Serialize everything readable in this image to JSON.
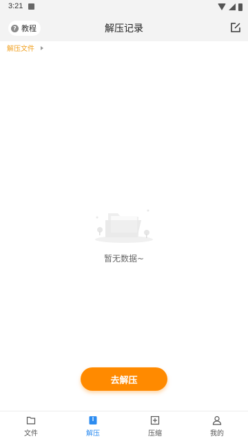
{
  "status_bar": {
    "time": "3:21"
  },
  "app_bar": {
    "tutorial_label": "教程",
    "title": "解压记录"
  },
  "breadcrumb": {
    "root": "解压文件"
  },
  "empty_state": {
    "message": "暂无数据~"
  },
  "action_button": {
    "label": "去解压"
  },
  "bottom_nav": {
    "items": [
      {
        "label": "文件",
        "icon": "folder-icon",
        "active": false
      },
      {
        "label": "解压",
        "icon": "unzip-icon",
        "active": true
      },
      {
        "label": "压缩",
        "icon": "archive-icon",
        "active": false
      },
      {
        "label": "我的",
        "icon": "user-icon",
        "active": false
      }
    ]
  },
  "colors": {
    "accent": "#ff8a00",
    "breadcrumb": "#f0a020",
    "active_tab": "#2d8cf0"
  }
}
